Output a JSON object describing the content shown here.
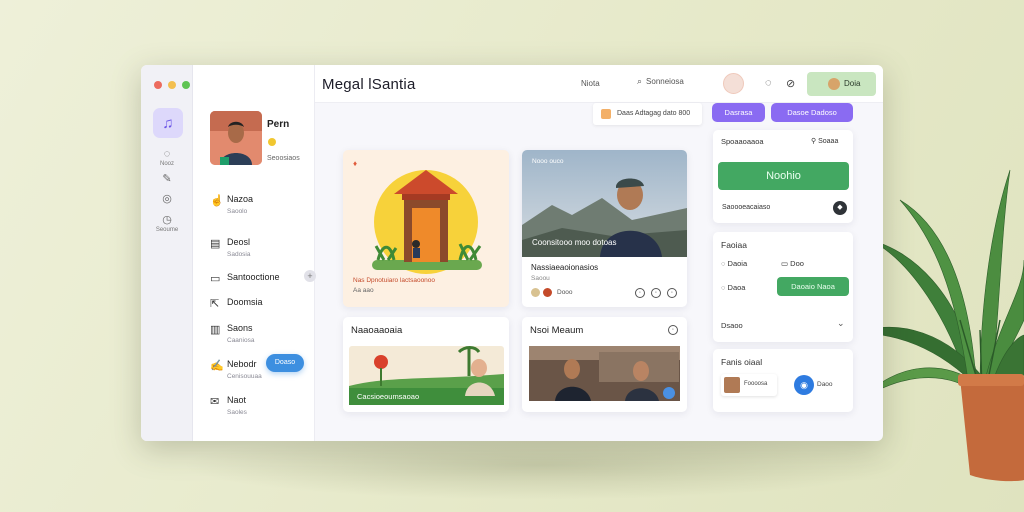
{
  "window": {
    "title": "Megal lSantia",
    "traffic_colors": [
      "#ec6b5e",
      "#f3bf4f",
      "#5fc454"
    ]
  },
  "rail": {
    "items": [
      {
        "icon": "chat-icon",
        "label": "Nooz"
      },
      {
        "icon": "edit-icon",
        "label": ""
      },
      {
        "icon": "settings-icon",
        "label": ""
      },
      {
        "icon": "clock-icon",
        "label": "Seoume"
      }
    ]
  },
  "profile": {
    "name": "Pern",
    "subtitle": "Seoosiaos"
  },
  "nav": [
    {
      "icon": "hand-icon",
      "title": "Nazoa",
      "sub": "Saoolo"
    },
    {
      "icon": "board-icon",
      "title": "Deosl",
      "sub": "Sadosia"
    },
    {
      "icon": "window-icon",
      "title": "Santooctione",
      "sub": ""
    },
    {
      "icon": "share-icon",
      "title": "Doomsia",
      "sub": ""
    },
    {
      "icon": "doc-icon",
      "title": "Saons",
      "sub": "Caaniosa"
    },
    {
      "icon": "pen-icon",
      "title": "Nebodr",
      "sub": "Cenisouuaa"
    },
    {
      "icon": "folder-icon",
      "title": "Naot",
      "sub": "Saoles"
    }
  ],
  "nav_pill": "Doaso",
  "header": {
    "search_label": "Niota",
    "search_text": "Sonneiosa",
    "user_label": "Doia"
  },
  "toolbar": {
    "filter_text": "Daas Adtagag dato 800",
    "btn1": "Dasrasa",
    "btn2": "Dasoe Dadoso"
  },
  "cards": {
    "card1": {
      "caption": "Nas Dpnotuiaro lactsaoonoo",
      "sub": "Aa aao"
    },
    "card2": {
      "badge": "Nooo ouco",
      "overlay": "Coonsitooo moo dotoas",
      "title": "Nassiaeaoionasios",
      "sub": "Saoou",
      "count": "Dooo"
    },
    "card3": {
      "title": "Naaoaaoaia",
      "banner": "Cacsioeoumsaoao"
    },
    "card4": {
      "title": "Nsoi Meaum"
    }
  },
  "right": {
    "panel1": {
      "title": "Spoaaoaaoa",
      "link": "Soaaa",
      "cta": "Noohio",
      "note": "Saoooeacaiaso"
    },
    "panel2": {
      "title": "Faoiaa",
      "opt1": "Daoia",
      "opt2": "Doo",
      "opt3": "Daoa",
      "btn": "Daoaio Naoa",
      "select": "Dsaoo"
    },
    "panel3": {
      "title": "Fanis oiaal",
      "chip": "Foooosa",
      "item": "Daoo"
    }
  }
}
